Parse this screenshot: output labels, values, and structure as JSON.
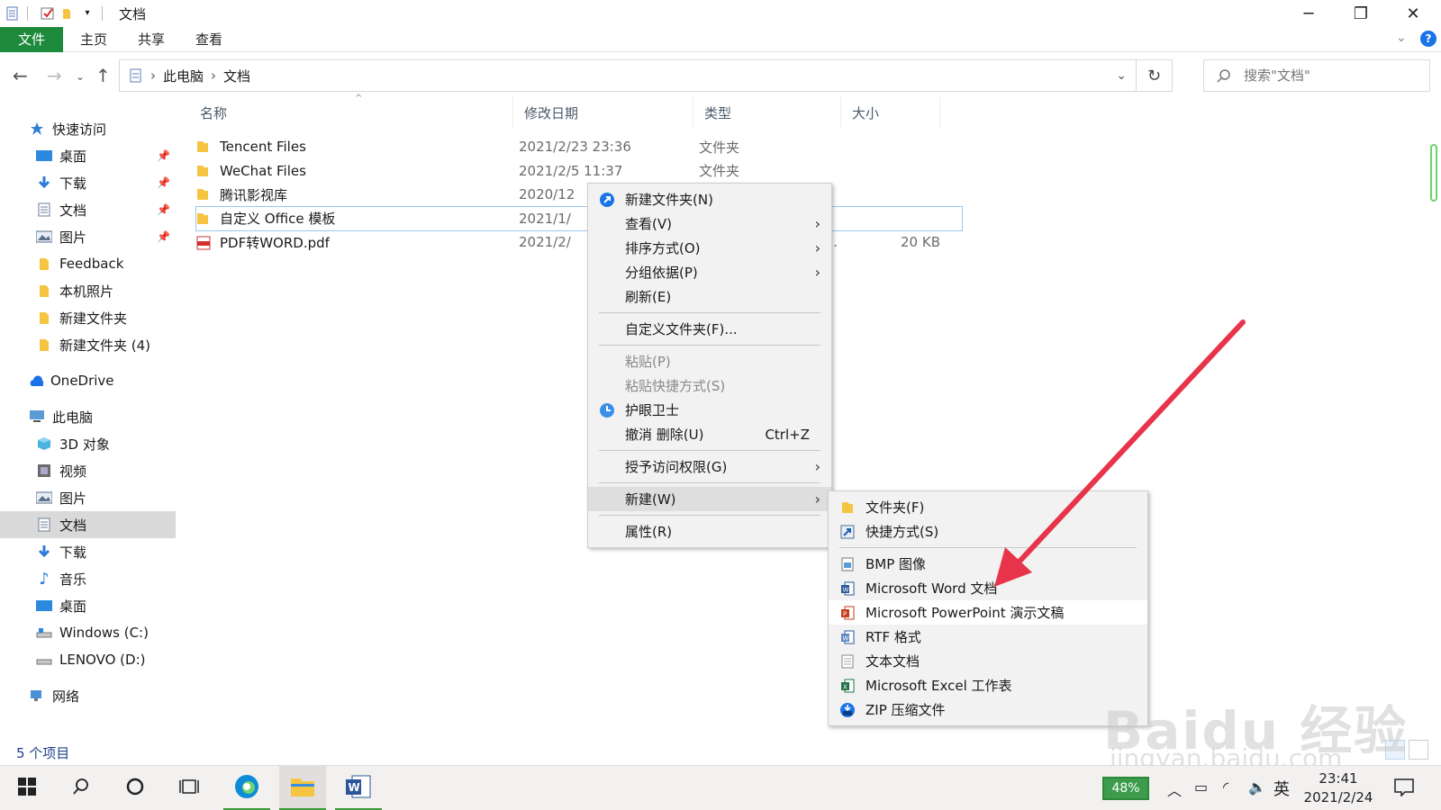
{
  "window": {
    "title": "文档",
    "minimize": "─",
    "restore": "❐",
    "close": "✕"
  },
  "ribbon": {
    "tabs": [
      "文件",
      "主页",
      "共享",
      "查看"
    ]
  },
  "address": {
    "crumbs": [
      "此电脑",
      "文档"
    ],
    "search_placeholder": "搜索\"文档\""
  },
  "sidebar": {
    "quick_access": "快速访问",
    "quick_items": [
      "桌面",
      "下载",
      "文档",
      "图片",
      "Feedback",
      "本机照片",
      "新建文件夹",
      "新建文件夹 (4)"
    ],
    "onedrive": "OneDrive",
    "this_pc": "此电脑",
    "pc_items": [
      "3D 对象",
      "视频",
      "图片",
      "文档",
      "下载",
      "音乐",
      "桌面",
      "Windows (C:)",
      "LENOVO (D:)"
    ],
    "network": "网络"
  },
  "columns": [
    "名称",
    "修改日期",
    "类型",
    "大小"
  ],
  "files": [
    {
      "name": "Tencent Files",
      "date": "2021/2/23 23:36",
      "type": "文件夹",
      "size": ""
    },
    {
      "name": "WeChat Files",
      "date": "2021/2/5 11:37",
      "type": "文件夹",
      "size": ""
    },
    {
      "name": "腾讯影视库",
      "date": "2020/12",
      "type": "",
      "size": ""
    },
    {
      "name": "自定义 Office 模板",
      "date": "2021/1/",
      "type": "",
      "size": ""
    },
    {
      "name": "PDF转WORD.pdf",
      "date": "2021/2/",
      "type": "P...",
      "size": "20 KB"
    }
  ],
  "status": {
    "count": "5 个项目"
  },
  "context_menu": {
    "new_folder": "新建文件夹(N)",
    "view": "查看(V)",
    "sort": "排序方式(O)",
    "group": "分组依据(P)",
    "refresh": "刷新(E)",
    "customize": "自定义文件夹(F)...",
    "paste": "粘贴(P)",
    "paste_shortcut": "粘贴快捷方式(S)",
    "eye_guard": "护眼卫士",
    "undo": "撤消 删除(U)",
    "undo_shortcut": "Ctrl+Z",
    "grant": "授予访问权限(G)",
    "new": "新建(W)",
    "properties": "属性(R)"
  },
  "submenu": {
    "folder": "文件夹(F)",
    "shortcut": "快捷方式(S)",
    "bmp": "BMP 图像",
    "word": "Microsoft Word 文档",
    "ppt": "Microsoft PowerPoint 演示文稿",
    "rtf": "RTF 格式",
    "txt": "文本文档",
    "excel": "Microsoft Excel 工作表",
    "zip": "ZIP 压缩文件"
  },
  "taskbar": {
    "battery": "48%",
    "ime": "英",
    "time": "23:41",
    "date": "2021/2/24"
  },
  "watermark": {
    "brand": "Baidu 经验",
    "url": "jingyan.baidu.com"
  },
  "colors": {
    "file_tab": "#1e8a3c",
    "arrow": "#e8344a",
    "selection": "#d9d9d9"
  }
}
